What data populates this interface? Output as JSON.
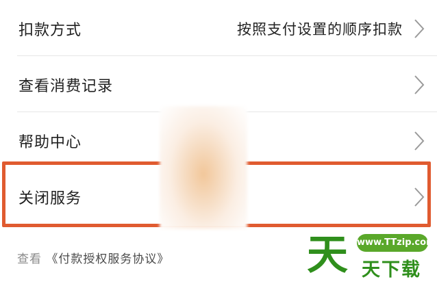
{
  "rows": [
    {
      "label": "扣款方式",
      "value": "按照支付设置的顺序扣款"
    },
    {
      "label": "查看消费记录"
    },
    {
      "label": "帮助中心"
    },
    {
      "label": "关闭服务"
    }
  ],
  "footer": {
    "prefix": "查看",
    "link": "《付款授权服务协议》"
  },
  "watermark": {
    "url": "www.TTzip.com",
    "big": "天",
    "sub": "天下载"
  },
  "colors": {
    "highlight": "#e05b30",
    "watermark": "#2f8f1c"
  }
}
